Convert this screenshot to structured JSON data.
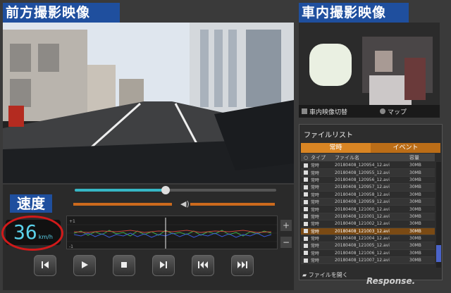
{
  "headings": {
    "front": "前方撮影映像",
    "cabin": "車内撮影映像"
  },
  "cabin_controls": {
    "switch_label": "車内映像切替",
    "map_label": "マップ"
  },
  "file_list": {
    "title": "ファイルリスト",
    "tabs": [
      "常時",
      "イベント"
    ],
    "columns": [
      "タイプ",
      "ファイル名",
      "容量"
    ],
    "rows": [
      {
        "type": "常時",
        "name": "20180408_120954_12.avi",
        "size": "30MB"
      },
      {
        "type": "常時",
        "name": "20180408_120955_12.avi",
        "size": "30MB"
      },
      {
        "type": "常時",
        "name": "20180408_120956_12.avi",
        "size": "30MB"
      },
      {
        "type": "常時",
        "name": "20180408_120957_12.avi",
        "size": "30MB"
      },
      {
        "type": "常時",
        "name": "20180408_120958_12.avi",
        "size": "30MB"
      },
      {
        "type": "常時",
        "name": "20180408_120959_12.avi",
        "size": "30MB"
      },
      {
        "type": "常時",
        "name": "20180408_121000_12.avi",
        "size": "30MB"
      },
      {
        "type": "常時",
        "name": "20180408_121001_12.avi",
        "size": "30MB"
      },
      {
        "type": "常時",
        "name": "20180408_121002_12.avi",
        "size": "30MB"
      },
      {
        "type": "常時",
        "name": "20180408_121003_12.avi",
        "size": "30MB"
      },
      {
        "type": "常時",
        "name": "20180408_121004_12.avi",
        "size": "30MB"
      },
      {
        "type": "常時",
        "name": "20180408_121005_12.avi",
        "size": "30MB"
      },
      {
        "type": "常時",
        "name": "20180408_121006_12.avi",
        "size": "30MB"
      },
      {
        "type": "常時",
        "name": "20180408_121007_12.avi",
        "size": "30MB"
      }
    ],
    "selected_index": 9,
    "open_label": "ファイルを開く"
  },
  "speed": {
    "label": "速度",
    "value": "36",
    "unit": "km/h"
  },
  "playback": {
    "progress": 0.45,
    "speed_level": 0.2,
    "volume_level": 1.0
  },
  "graph": {
    "plus_label": "+",
    "minus_label": "−",
    "top_axis_label": "+1",
    "bottom_axis_label": "-1"
  },
  "controls": [
    "skip-to-start-icon",
    "play-icon",
    "stop-icon",
    "next-frame-icon",
    "rewind-icon",
    "fast-forward-icon"
  ],
  "watermark": "Response."
}
